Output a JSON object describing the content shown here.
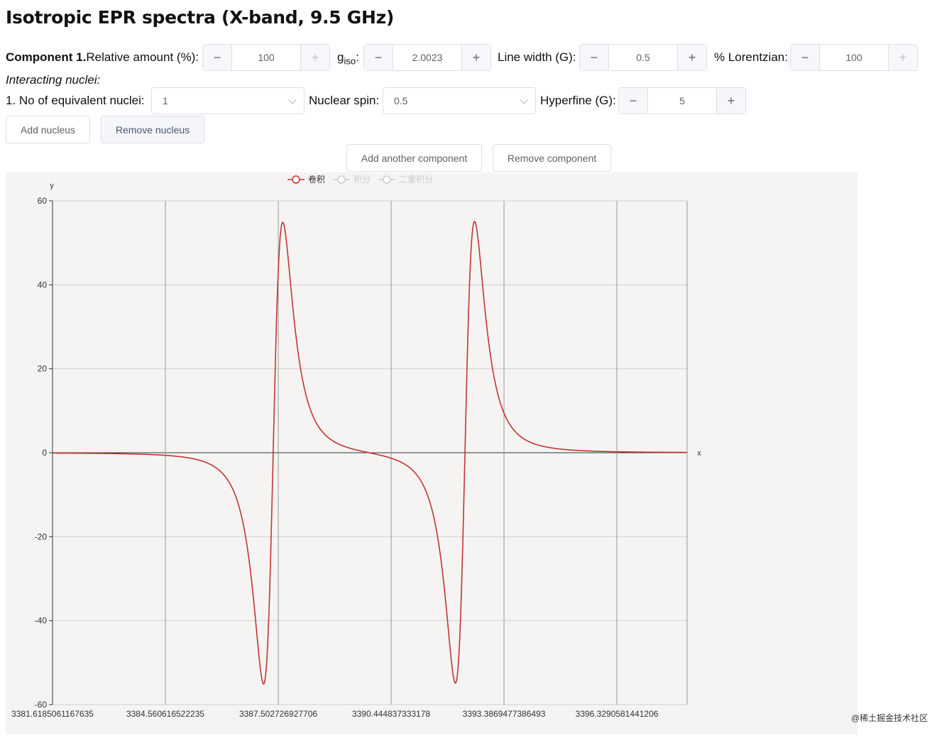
{
  "title": "Isotropic EPR spectra (X-band, 9.5 GHz)",
  "component": {
    "heading": "Component 1.",
    "relative_amount": {
      "label": "Relative amount (%):",
      "value": "100"
    },
    "giso": {
      "label_main": "g",
      "label_sub": "iso",
      "label_colon": ":",
      "value": "2.0023"
    },
    "line_width": {
      "label": "Line width (G):",
      "value": "0.5"
    },
    "lorentzian": {
      "label": "% Lorentzian:",
      "value": "100"
    },
    "nuclei_heading": "Interacting nuclei:",
    "nucleus": {
      "equiv_label": "1. No of equivalent nuclei:",
      "equiv_value": "1",
      "spin_label": "Nuclear spin:",
      "spin_value": "0.5",
      "hyperfine_label": "Hyperfine (G):",
      "hyperfine_value": "5"
    },
    "add_nucleus": "Add nucleus",
    "remove_nucleus": "Remove nucleus"
  },
  "add_component": "Add another component",
  "remove_component": "Remove component",
  "stepper": {
    "minus": "−",
    "plus": "+"
  },
  "watermark": "@稀土掘金技术社区",
  "chart_data": {
    "type": "line",
    "xlabel": "x",
    "ylabel": "y",
    "xlim": [
      3381.6185061167635,
      3398.16
    ],
    "ylim": [
      -60,
      60
    ],
    "yticks": [
      "60",
      "40",
      "20",
      "0",
      "-20",
      "-40",
      "-60"
    ],
    "xticks": [
      "3381.6185061167635",
      "3384.560616522235",
      "3387.502726927706",
      "3390.444837333178",
      "3393.3869477386493",
      "3396.3290581441206"
    ],
    "grid": true,
    "legend_position": "top-center",
    "legend": [
      {
        "name": "卷积",
        "active": true
      },
      {
        "name": "积分",
        "active": false
      },
      {
        "name": "二重积分",
        "active": false
      }
    ],
    "series": [
      {
        "name": "卷积",
        "color": "#c23531",
        "lineshape": "first-derivative Lorentzian",
        "line_centers": [
          3387.37,
          3392.37
        ],
        "peak_to_peak_width": 0.5,
        "peak_amplitude": 55
      }
    ]
  }
}
